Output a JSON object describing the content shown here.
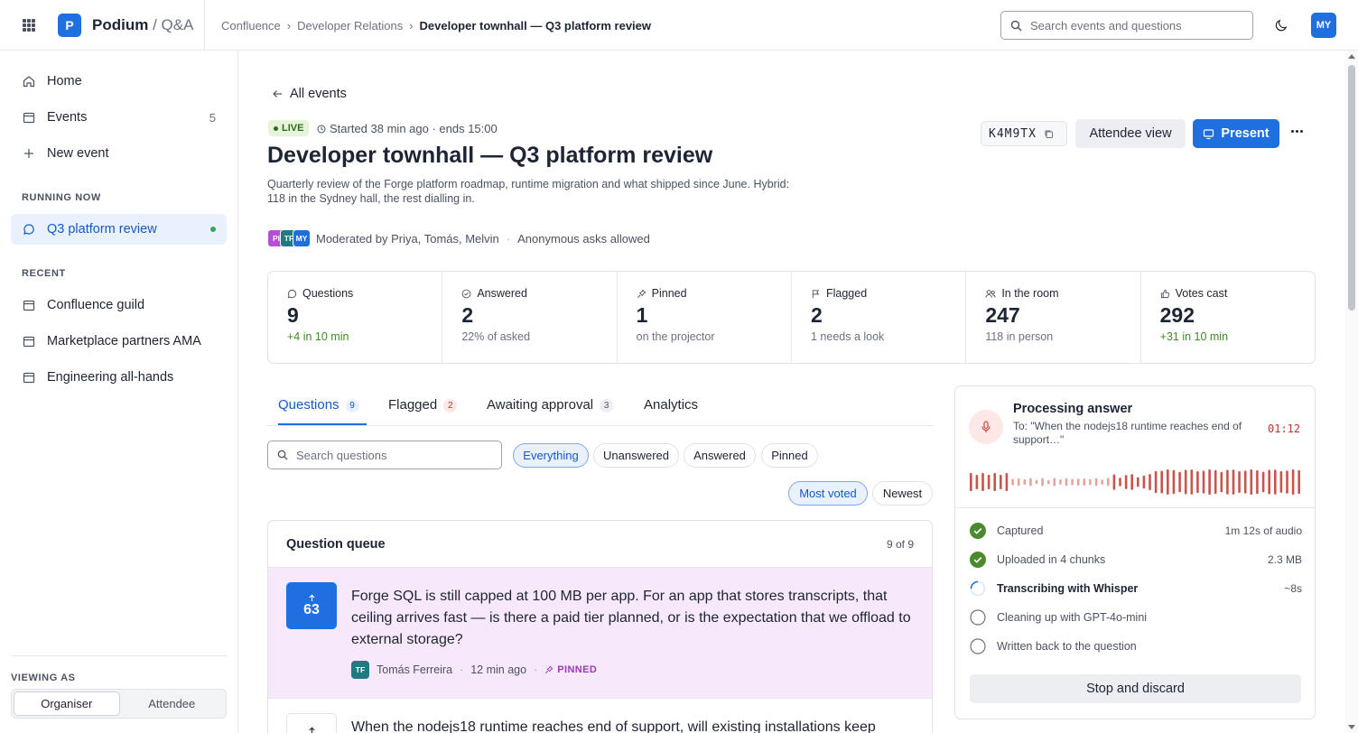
{
  "header": {
    "logo_letter": "P",
    "brand_name": "Podium",
    "brand_suffix": "/ Q&A",
    "breadcrumbs": [
      "Confluence",
      "Developer Relations",
      "Developer townhall — Q3 platform review"
    ],
    "search_placeholder": "Search events and questions",
    "user_initials": "MY",
    "icons": {
      "apps": "grid-icon",
      "search": "search-icon",
      "theme": "moon-icon"
    }
  },
  "sidebar": {
    "nav": [
      {
        "label": "Home",
        "icon": "home-icon"
      },
      {
        "label": "Events",
        "icon": "calendar-icon",
        "count": "5"
      },
      {
        "label": "New event",
        "icon": "plus-icon"
      }
    ],
    "running_label": "RUNNING NOW",
    "running": {
      "label": "Q3 platform review",
      "icon": "chat-icon",
      "status_color": "#3aa655"
    },
    "recent_label": "RECENT",
    "recent": [
      {
        "label": "Confluence guild"
      },
      {
        "label": "Marketplace partners AMA"
      },
      {
        "label": "Engineering all-hands"
      }
    ],
    "viewing_label": "VIEWING AS",
    "viewing_options": [
      "Organiser",
      "Attendee"
    ],
    "viewing_selected": "Organiser"
  },
  "event": {
    "back_label": "All events",
    "live_label": "LIVE",
    "started_text": "Started 38 min ago · ends 15:00",
    "title": "Developer townhall — Q3 platform review",
    "description": "Quarterly review of the Forge platform roadmap, runtime migration and what shipped since June. Hybrid: 118 in the Sydney hall, the rest dialling in.",
    "moderators": [
      {
        "initials": "PI",
        "color": "#b34fd6"
      },
      {
        "initials": "TF",
        "color": "#1f7a83"
      },
      {
        "initials": "MY",
        "color": "#1f6fe0"
      }
    ],
    "moderated_text": "Moderated by Priya, Tomás, Melvin",
    "anonymous_text": "Anonymous asks allowed",
    "code": "K4M9TX",
    "attendee_view_label": "Attendee view",
    "present_label": "Present",
    "accent": "#1f6fe0"
  },
  "stats": [
    {
      "label": "Questions",
      "value": "9",
      "sub": "+4 in 10 min",
      "positive": true,
      "icon": "chat-icon"
    },
    {
      "label": "Answered",
      "value": "2",
      "sub": "22% of asked",
      "positive": false,
      "icon": "check-circle-icon"
    },
    {
      "label": "Pinned",
      "value": "1",
      "sub": "on the projector",
      "positive": false,
      "icon": "pin-icon"
    },
    {
      "label": "Flagged",
      "value": "2",
      "sub": "1 needs a look",
      "positive": false,
      "icon": "flag-icon"
    },
    {
      "label": "In the room",
      "value": "247",
      "sub": "118 in person",
      "positive": false,
      "icon": "people-icon"
    },
    {
      "label": "Votes cast",
      "value": "292",
      "sub": "+31 in 10 min",
      "positive": true,
      "icon": "thumbs-up-icon"
    }
  ],
  "tabs": [
    {
      "label": "Questions",
      "count": "9"
    },
    {
      "label": "Flagged",
      "count": "2"
    },
    {
      "label": "Awaiting approval",
      "count": "3"
    },
    {
      "label": "Analytics"
    }
  ],
  "filters": {
    "search_placeholder": "Search questions",
    "chips": [
      "Everything",
      "Unanswered",
      "Answered",
      "Pinned"
    ],
    "selected_chip": "Everything",
    "sort": [
      "Most voted",
      "Newest"
    ],
    "selected_sort": "Most voted"
  },
  "queue": {
    "title": "Question queue",
    "count_text": "9 of 9",
    "questions": [
      {
        "votes": "63",
        "text": "Forge SQL is still capped at 100 MB per app. For an app that stores transcripts, that ceiling arrives fast — is there a paid tier planned, or is the expectation that we offload to external storage?",
        "author_initials": "TF",
        "author": "Tomás Ferreira",
        "time": "12 min ago",
        "tag": "PINNED"
      },
      {
        "text": "When the nodejs18 runtime reaches end of support, will existing installations keep"
      }
    ]
  },
  "processing": {
    "title": "Processing answer",
    "to_text": "To: \"When the nodejs18 runtime reaches end of support…\"",
    "timer": "01:12",
    "accent": "#c0362c",
    "steps": [
      {
        "label": "Captured",
        "meta": "1m 12s of audio",
        "state": "done"
      },
      {
        "label": "Uploaded in 4 chunks",
        "meta": "2.3 MB",
        "state": "done"
      },
      {
        "label": "Transcribing with Whisper",
        "meta": "~8s",
        "state": "active"
      },
      {
        "label": "Cleaning up with GPT-4o-mini",
        "meta": "",
        "state": "pending"
      },
      {
        "label": "Written back to the question",
        "meta": "",
        "state": "pending"
      }
    ],
    "stop_label": "Stop and discard"
  }
}
